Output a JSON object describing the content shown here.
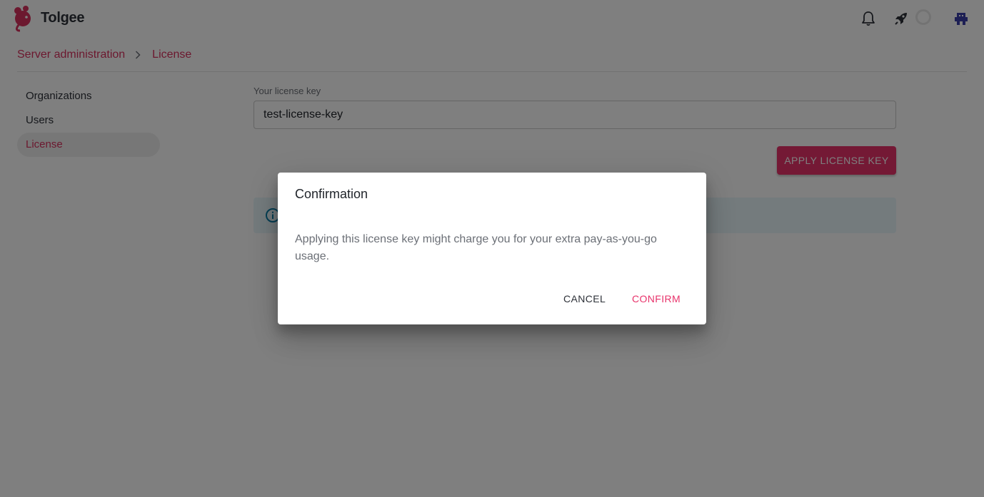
{
  "app": {
    "brand": "Tolgee",
    "icons": {
      "logo": "tolgee-mouse-logo",
      "notifications": "bell-icon",
      "quick_start": "rocket-icon",
      "loading": "spinner-icon",
      "user": "user-avatar-icon"
    }
  },
  "breadcrumb": {
    "items": [
      "Server administration",
      "License"
    ]
  },
  "sidebar": {
    "items": [
      {
        "label": "Organizations",
        "active": false
      },
      {
        "label": "Users",
        "active": false
      },
      {
        "label": "License",
        "active": true
      }
    ]
  },
  "license_form": {
    "label": "Your license key",
    "value": "test-license-key",
    "apply_label": "APPLY LICENSE KEY"
  },
  "dialog": {
    "title": "Confirmation",
    "message": "Applying this license key might charge you for your extra pay-as-you-go usage.",
    "cancel_label": "CANCEL",
    "confirm_label": "CONFIRM"
  },
  "colors": {
    "accent": "#e8336b",
    "breadcrumb": "#d9315e",
    "info_bg": "#e8f7fb",
    "info_icon": "#0d7fa8"
  }
}
